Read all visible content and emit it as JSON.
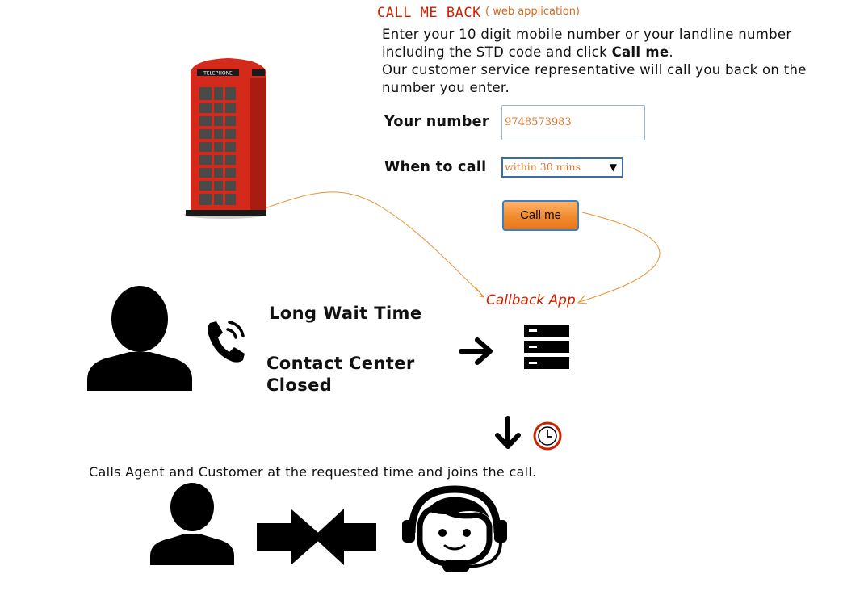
{
  "title": "CALL ME BACK",
  "subtitle": "( web application)",
  "instructions": {
    "line1": "Enter your 10 digit mobile number or your landline number",
    "line2_prefix": "including the STD code and click ",
    "line2_bold": "Call me",
    "line2_suffix": ".",
    "line3": "Our customer service representative will call you back on the",
    "line4": "number you enter."
  },
  "form": {
    "number_label": "Your number",
    "number_value": "9748573983",
    "when_label": "When to call",
    "when_value": "within 30 mins",
    "button_label": "Call me"
  },
  "phone_booth_sign": "TELEPHONE",
  "callback_app_label": "Callback App",
  "reasons": {
    "long_wait": "Long Wait Time",
    "closed_line1": "Contact Center",
    "closed_line2": "Closed"
  },
  "bottom_caption": "Calls Agent and Customer at the requested time and joins the call.",
  "colors": {
    "accent_red": "#cc2200",
    "orange": "#f08a2c",
    "connector": "#e8932f",
    "icon_black": "#000000"
  },
  "icons": [
    "person-icon",
    "phone-call-icon",
    "right-arrow-icon",
    "server-icon",
    "down-arrow-icon",
    "clock-icon",
    "merge-arrows-icon",
    "agent-headset-icon",
    "phone-booth-icon"
  ]
}
